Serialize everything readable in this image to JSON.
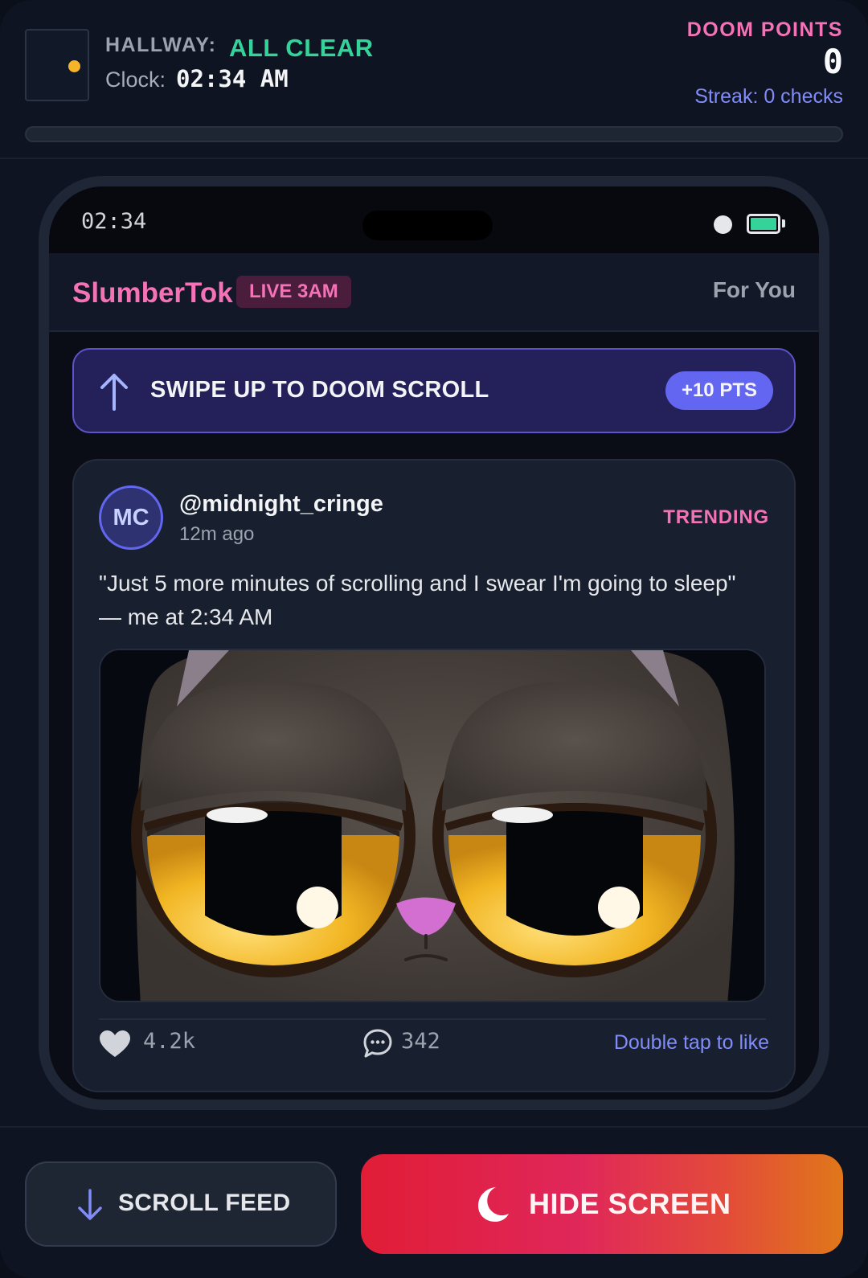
{
  "hud": {
    "hallway_label": "HALLWAY:",
    "hallway_status": "ALL CLEAR",
    "clock_label": "Clock:",
    "clock_value": "02:34 AM",
    "score_label": "DOOM POINTS",
    "score_value": "0",
    "streak": "Streak: 0 checks",
    "progress_fraction": 0,
    "door_icon": "door-icon",
    "colors": {
      "clear": "#34d399",
      "accent": "#f472b6",
      "streak": "#818cf8"
    }
  },
  "phone": {
    "status_time": "02:34",
    "battery_level": 1,
    "app": {
      "name": "SlumberTok",
      "live_badge": "LIVE 3AM",
      "tab": "For You"
    },
    "banner": {
      "text": "SWIPE UP TO DOOM SCROLL",
      "points": "+10 PTS",
      "icon": "arrow-up-icon"
    },
    "post": {
      "avatar_initials": "MC",
      "username": "@midnight_cringe",
      "time": "12m ago",
      "tag": "TRENDING",
      "text": "\"Just 5 more minutes of scrolling and I swear I'm going to sleep\" — me at 2:34 AM",
      "media_icon": "sleepy-cat-image",
      "likes": "4.2k",
      "comments": "342",
      "hint": "Double tap to like"
    }
  },
  "actions": {
    "scroll_label": "SCROLL FEED",
    "hide_label": "HIDE SCREEN",
    "scroll_icon": "arrow-down-icon",
    "hide_icon": "moon-icon"
  }
}
